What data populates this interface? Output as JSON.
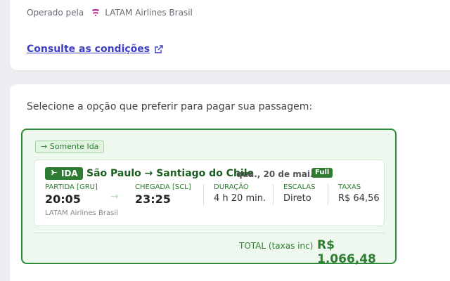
{
  "top_card": {
    "operated_by_label": "Operado pela",
    "airline": "LATAM Airlines Brasil",
    "conditions_link": "Consulte as condições"
  },
  "payment": {
    "instruction": "Selecione a opção que preferir para pagar sua passagem:",
    "option": {
      "tag": "→ Somente Ida",
      "flight": {
        "direction_badge": "IDA",
        "route": "São Paulo → Santiago do Chile",
        "date": "qua., 20 de mai.",
        "fare_badge": "Full",
        "departure_label": "PARTIDA [GRU]",
        "departure_time": "20:05",
        "arrival_label": "CHEGADA [SCL]",
        "arrival_time": "23:25",
        "duration_label": "DURAÇÃO",
        "duration_value": "4 h 20 min.",
        "stops_label": "ESCALAS",
        "stops_value": "Direto",
        "taxes_label": "TAXAS",
        "taxes_value": "R$ 64,56",
        "airline": "LATAM Airlines Brasil"
      },
      "total_label": "TOTAL (taxas inc)",
      "total_value": "R$ 1.066,48"
    }
  },
  "colors": {
    "accent_green": "#2e7d32",
    "link_blue": "#3d3dc8",
    "latam_magenta": "#b5157e"
  },
  "icons": [
    "latam-logo-icon",
    "external-link-icon",
    "plane-icon",
    "arrow-right-icon"
  ]
}
